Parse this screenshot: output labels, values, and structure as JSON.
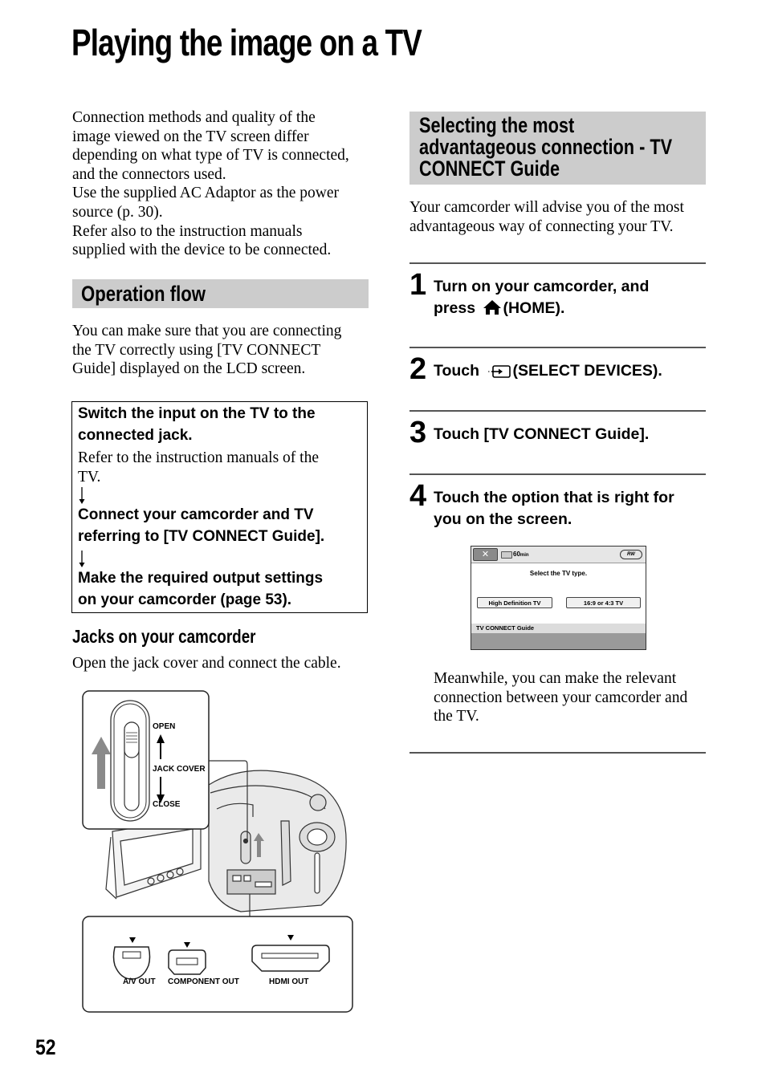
{
  "page": {
    "title": "Playing the image on a TV",
    "number": "52"
  },
  "left_column": {
    "intro_lines": [
      "Connection methods and quality of the",
      "image viewed on the TV screen differ",
      "depending on what type of TV is connected,",
      "and the connectors used.",
      "Use the supplied AC Adaptor as the power",
      "source (p. 30).",
      "Refer also to the instruction manuals",
      "supplied with the device to be connected."
    ],
    "operation_flow": {
      "heading": "Operation flow",
      "description_lines": [
        "You can make sure that you are connecting",
        "the TV correctly using [TV CONNECT",
        "Guide] displayed on the LCD screen."
      ],
      "box": {
        "step1_lines": [
          "Switch the input on the TV to the",
          "connected jack."
        ],
        "step1_note_lines": [
          "Refer to the instruction manuals of the",
          "TV."
        ],
        "step2_lines": [
          "Connect your camcorder and TV",
          "referring to [TV CONNECT Guide]."
        ],
        "step3_lines": [
          "Make the required output settings",
          "on your camcorder (page 53)."
        ],
        "arrow_icon": "down-arrow"
      }
    },
    "jacks": {
      "heading": "Jacks on your camcorder",
      "description": "Open the jack cover and connect the cable.",
      "illustration": {
        "cover_labels": {
          "open": "OPEN",
          "jack_cover": "JACK COVER",
          "close": "CLOSE"
        },
        "jack_labels": {
          "av_out": "A/V OUT",
          "component_out": "COMPONENT OUT",
          "hdmi_out": "HDMI OUT"
        }
      }
    }
  },
  "right_column": {
    "section": {
      "heading_lines": [
        "Selecting the most",
        "advantageous connection - TV",
        "CONNECT Guide"
      ],
      "description_lines": [
        "Your camcorder will advise you of the most",
        "advantageous way of connecting your TV."
      ]
    },
    "steps": [
      {
        "number": "1",
        "lines": [
          "Turn on your camcorder, and",
          "press",
          "(HOME)."
        ],
        "icon": "home-icon"
      },
      {
        "number": "2",
        "lines": [
          "Touch",
          "(SELECT DEVICES)."
        ],
        "icon": "select-devices-icon"
      },
      {
        "number": "3",
        "lines": [
          "Touch [TV CONNECT Guide]."
        ]
      },
      {
        "number": "4",
        "lines": [
          "Touch the option that is right for",
          "you on the screen."
        ]
      }
    ],
    "lcd_screen": {
      "close_label": "✕",
      "remaining": "60",
      "remaining_unit": "min",
      "media_badge": "RW",
      "prompt": "Select the TV type.",
      "option_hd": "High Definition TV",
      "option_sd": "16:9 or 4:3 TV",
      "footer": "TV CONNECT Guide"
    },
    "meanwhile_lines": [
      "Meanwhile, you can make the relevant",
      "connection between your camcorder and",
      "the TV."
    ]
  }
}
